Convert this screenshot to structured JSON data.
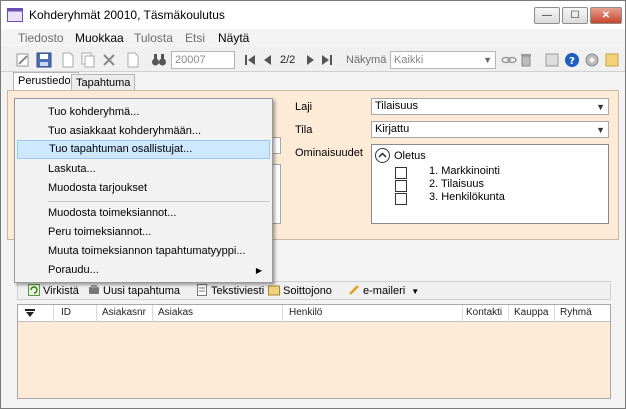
{
  "window": {
    "title": "Kohderyhmät 20010, Täsmäkoulutus",
    "controls": {
      "minimize": "—",
      "maximize": "☐",
      "close": "✕"
    }
  },
  "menubar": {
    "items": [
      {
        "label": "Tiedosto",
        "active": false
      },
      {
        "label": "Muokkaa",
        "active": true
      },
      {
        "label": "Tulosta",
        "active": false
      },
      {
        "label": "Etsi",
        "active": false
      },
      {
        "label": "Näytä",
        "active": true
      }
    ]
  },
  "toolbar": {
    "record_id": "20007",
    "pager": "2/2",
    "view_label": "Näkymä",
    "view_value": "Kaikki"
  },
  "tabs": [
    {
      "label": "Perustiedot",
      "selected": true
    },
    {
      "label": "Tapahtuma",
      "selected": false
    }
  ],
  "form": {
    "laji_label": "Laji",
    "laji_value": "Tilaisuus",
    "tila_label": "Tila",
    "tila_value": "Kirjattu",
    "ominaisuudet_label": "Ominaisuudet",
    "properties": {
      "header": "Oletus",
      "items": [
        {
          "label": "1. Markkinointi",
          "checked": false
        },
        {
          "label": "2. Tilaisuus",
          "checked": false
        },
        {
          "label": "3. Henkilökunta",
          "checked": false
        }
      ]
    }
  },
  "context_menu": {
    "items": [
      {
        "label": "Tuo kohderyhmä...",
        "hover": false,
        "submenu": false
      },
      {
        "label": "Tuo asiakkaat kohderyhmään...",
        "hover": false,
        "submenu": false
      },
      {
        "label": "Tuo tapahtuman osallistujat...",
        "hover": true,
        "submenu": false
      },
      {
        "label": "Laskuta...",
        "hover": false,
        "submenu": false
      },
      {
        "label": "Muodosta tarjoukset",
        "hover": false,
        "submenu": false
      },
      {
        "label": "Muodosta toimeksiannot...",
        "hover": false,
        "submenu": false
      },
      {
        "label": "Peru toimeksiannot...",
        "hover": false,
        "submenu": false
      },
      {
        "label": "Muuta toimeksiannon tapahtumatyyppi...",
        "hover": false,
        "submenu": false
      },
      {
        "label": "Poraudu...",
        "hover": false,
        "submenu": true
      }
    ]
  },
  "lower_toolbar": {
    "refresh_label": "Virkistä",
    "new_event_label": "Uusi tapahtuma",
    "sms_label": "Tekstiviesti",
    "call_queue_label": "Soittojono",
    "email_label": "e-maileri"
  },
  "grid": {
    "columns": [
      "ID",
      "Asiakasnr",
      "Asiakas",
      "Henkilö",
      "Kontakti",
      "Kauppa",
      "Ryhmä"
    ]
  },
  "colors": {
    "panel_bg": "#fdebd8",
    "hover_bg": "#cde8ff",
    "close_button": "#c7452e"
  }
}
